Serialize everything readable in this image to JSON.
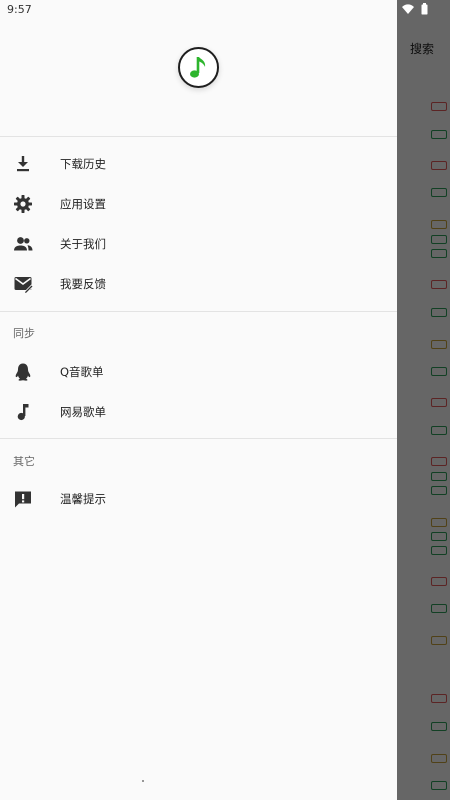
{
  "status_bar": {
    "time": "9:57"
  },
  "background": {
    "search_label": "搜索"
  },
  "drawer": {
    "logo_icon": "music-note-icon",
    "accent_color": "#2db52d",
    "items": [
      {
        "label": "下载历史",
        "icon": "download-icon"
      },
      {
        "label": "应用设置",
        "icon": "gear-icon"
      },
      {
        "label": "关于我们",
        "icon": "people-icon"
      },
      {
        "label": "我要反馈",
        "icon": "feedback-icon"
      }
    ],
    "sections": [
      {
        "title": "同步",
        "items": [
          {
            "label": "Q音歌单",
            "icon": "penguin-icon"
          },
          {
            "label": "网易歌单",
            "icon": "music-note-icon"
          }
        ]
      },
      {
        "title": "其它",
        "items": [
          {
            "label": "温馨提示",
            "icon": "exclamation-chat-icon"
          }
        ]
      }
    ]
  }
}
